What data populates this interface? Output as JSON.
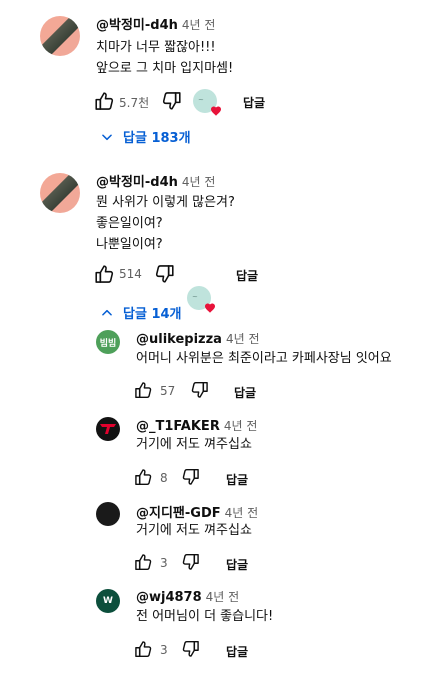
{
  "colors": {
    "link_blue": "#065fd4",
    "heart_red": "#e8133a",
    "avatar_green": "#4ea05a",
    "avatar_teal": "#0c4f3c",
    "avatar_dark": "#121212"
  },
  "comments": [
    {
      "author": "@박정미-d4h",
      "time": "4년 전",
      "lines": [
        "치마가 너무 짧잖아!!!",
        "앞으로 그 치마 입지마셈!"
      ],
      "likes": "5.7천",
      "reply_label": "답글",
      "replies_toggle": "답글 183개",
      "toggle_icon": "chevron-down-icon"
    },
    {
      "author": "@박정미-d4h",
      "time": "4년 전",
      "lines": [
        "뭔 사위가 이렇게 많은겨?",
        "좋은일이여?",
        "나뿐일이여?"
      ],
      "likes": "514",
      "reply_label": "답글",
      "replies_toggle": "답글 14개",
      "toggle_icon": "chevron-up-icon",
      "replies": [
        {
          "author": "@ulikepizza",
          "time": "4년 전",
          "text": "어머니 사위분은 최준이라고  카페사장님 잇어요",
          "likes": "57",
          "reply_label": "답글",
          "avatar_text": "빔빔"
        },
        {
          "author": "@_T1FAKER",
          "time": "4년 전",
          "text": "거기에 저도 껴주십쇼",
          "likes": "8",
          "reply_label": "답글"
        },
        {
          "author": "@지디팬-GDF",
          "time": "4년 전",
          "text": "거기에 저도 껴주십쇼",
          "likes": "3",
          "reply_label": "답글"
        },
        {
          "author": "@wj4878",
          "time": "4년 전",
          "text": "전 어머님이 더 좋습니다!",
          "likes": "3",
          "reply_label": "답글",
          "avatar_text": "W"
        }
      ]
    }
  ]
}
